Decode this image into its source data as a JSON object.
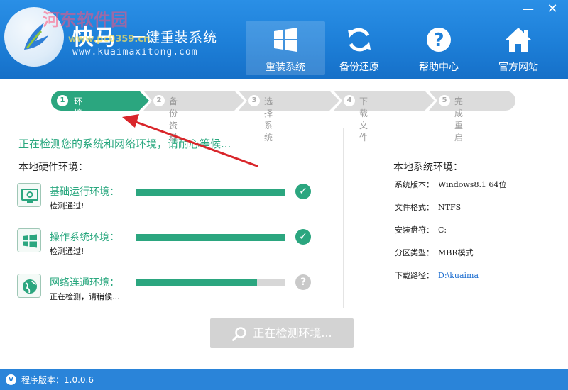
{
  "app": {
    "brand_big": "快马",
    "brand_sub": "一键重装系统",
    "url": "www.kuaimaxitong.com",
    "watermark": "河东软件园",
    "watermark_url": "www.pc0359.cn",
    "minimize_glyph": "—",
    "close_glyph": "✕"
  },
  "nav": [
    {
      "label": "重装系统",
      "icon": "windows-icon",
      "active": true
    },
    {
      "label": "备份还原",
      "icon": "refresh-icon",
      "active": false
    },
    {
      "label": "帮助中心",
      "icon": "question-icon",
      "active": false
    },
    {
      "label": "官方网站",
      "icon": "home-icon",
      "active": false
    }
  ],
  "steps": [
    {
      "num": "1",
      "label": "环境检测",
      "active": true
    },
    {
      "num": "2",
      "label": "备份资料",
      "active": false
    },
    {
      "num": "3",
      "label": "选择系统",
      "active": false
    },
    {
      "num": "4",
      "label": "下载文件",
      "active": false
    },
    {
      "num": "5",
      "label": "完成重启",
      "active": false
    }
  ],
  "status_text": "正在检测您的系统和网络环境，请耐心等候...",
  "hardware": {
    "title": "本地硬件环境：",
    "rows": [
      {
        "title": "基础运行环境：",
        "sub": "检测通过!",
        "progress": 1.0,
        "state": "ok",
        "icon": "monitor-gear-icon"
      },
      {
        "title": "操作系统环境：",
        "sub": "检测通过!",
        "progress": 1.0,
        "state": "ok",
        "icon": "windows-icon"
      },
      {
        "title": "网络连通环境：",
        "sub": "正在检测，请稍候...",
        "progress": 0.81,
        "state": "pending",
        "icon": "globe-icon"
      }
    ]
  },
  "system": {
    "title": "本地系统环境：",
    "rows": [
      {
        "label": "系统版本：",
        "value": "Windows8.1  64位"
      },
      {
        "label": "文件格式：",
        "value": "NTFS"
      },
      {
        "label": "安装盘符：",
        "value": "C:"
      },
      {
        "label": "分区类型：",
        "value": "MBR模式"
      },
      {
        "label": "下载路径：",
        "value": "D:\\kuaima",
        "link": true
      }
    ]
  },
  "main_button": "正在检测环境...",
  "footer": {
    "badge": "V",
    "version": "程序版本：1.0.0.6"
  },
  "colors": {
    "header_blue": "#1d7fd8",
    "accent_green": "#2ba67f",
    "step_inactive": "#dcdcdc",
    "annotation_red": "#d9262b",
    "footer_blue": "#2a84d9"
  }
}
